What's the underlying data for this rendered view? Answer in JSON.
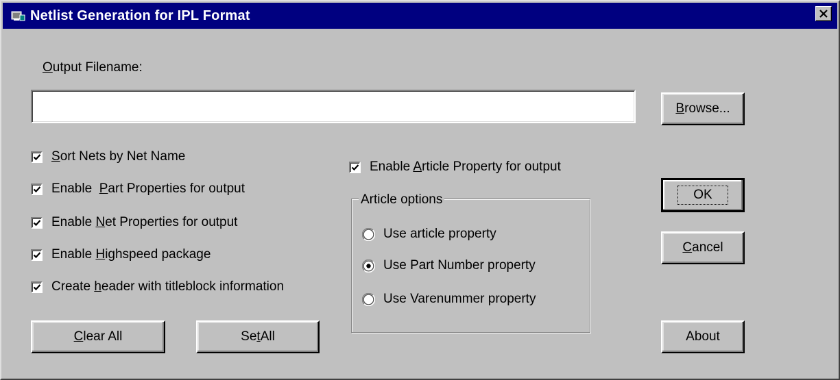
{
  "window": {
    "title": "Netlist Generation for IPL Format",
    "titlebar_color": "#000080",
    "background": "#c0c0c0"
  },
  "output": {
    "label_prefix": "",
    "label_accel": "O",
    "label_rest": "utput Filename:",
    "value": "",
    "placeholder": ""
  },
  "browse_button": {
    "pre": "",
    "accel": "B",
    "post": "rowse..."
  },
  "checkboxes": [
    {
      "pre": "",
      "accel": "S",
      "post": "ort Nets by Net Name",
      "checked": true
    },
    {
      "pre": "Enable  ",
      "accel": "P",
      "post": "art Properties for output",
      "checked": true
    },
    {
      "pre": "Enable ",
      "accel": "N",
      "post": "et Properties for output",
      "checked": true
    },
    {
      "pre": "Enable ",
      "accel": "H",
      "post": "ighspeed package",
      "checked": true
    },
    {
      "pre": "Create ",
      "accel": "h",
      "post": "eader with titleblock information",
      "checked": true
    }
  ],
  "article_checkbox": {
    "pre": "Enable ",
    "accel": "A",
    "post": "rticle Property for output",
    "checked": true
  },
  "article_options": {
    "legend": "Article options",
    "options": [
      {
        "label": "Use article property",
        "selected": false
      },
      {
        "label": "Use Part Number property",
        "selected": true
      },
      {
        "label": "Use Varenummer property",
        "selected": false
      }
    ]
  },
  "buttons": {
    "clear_all": {
      "pre": "",
      "accel": "C",
      "post": "lear All"
    },
    "set_all": {
      "pre": "Se",
      "accel": "t",
      "post": " All"
    },
    "ok": {
      "label": "OK"
    },
    "cancel": {
      "pre": "",
      "accel": "C",
      "post": "ancel"
    },
    "about": {
      "label": "About"
    }
  }
}
